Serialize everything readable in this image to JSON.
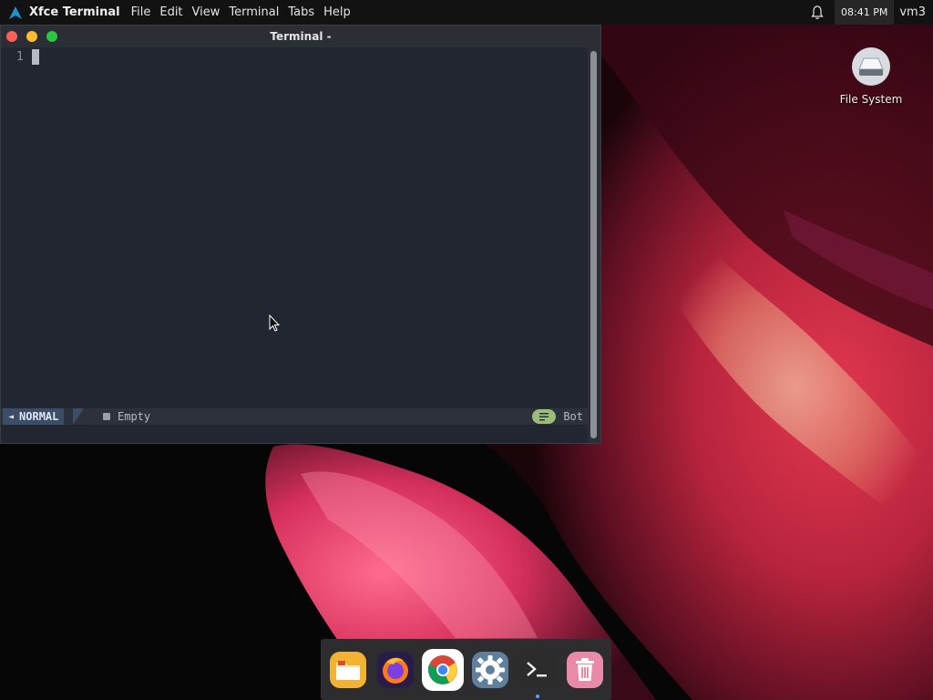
{
  "top_panel": {
    "app_name": "Xfce Terminal",
    "menu": [
      {
        "label": "File"
      },
      {
        "label": "Edit"
      },
      {
        "label": "View"
      },
      {
        "label": "Terminal"
      },
      {
        "label": "Tabs"
      },
      {
        "label": "Help"
      }
    ],
    "clock": "08:41 PM",
    "user": "vm3"
  },
  "terminal": {
    "title": "Terminal -",
    "line_number": "1",
    "statusline": {
      "mode": "NORMAL",
      "buffer": "Empty",
      "position": "Bot"
    }
  },
  "desktop": {
    "icons": [
      {
        "label": "File System",
        "icon": "drive-icon"
      }
    ]
  },
  "dock": {
    "items": [
      {
        "name": "files-icon",
        "color": "#f2b233"
      },
      {
        "name": "firefox-icon",
        "color": "#ff7a1a"
      },
      {
        "name": "chrome-icon",
        "color": "#ffffff"
      },
      {
        "name": "settings-icon",
        "color": "#5f7f9c"
      },
      {
        "name": "terminal-icon",
        "color": "#2c2c2c"
      },
      {
        "name": "trash-icon",
        "color": "#e98aa8"
      }
    ]
  }
}
